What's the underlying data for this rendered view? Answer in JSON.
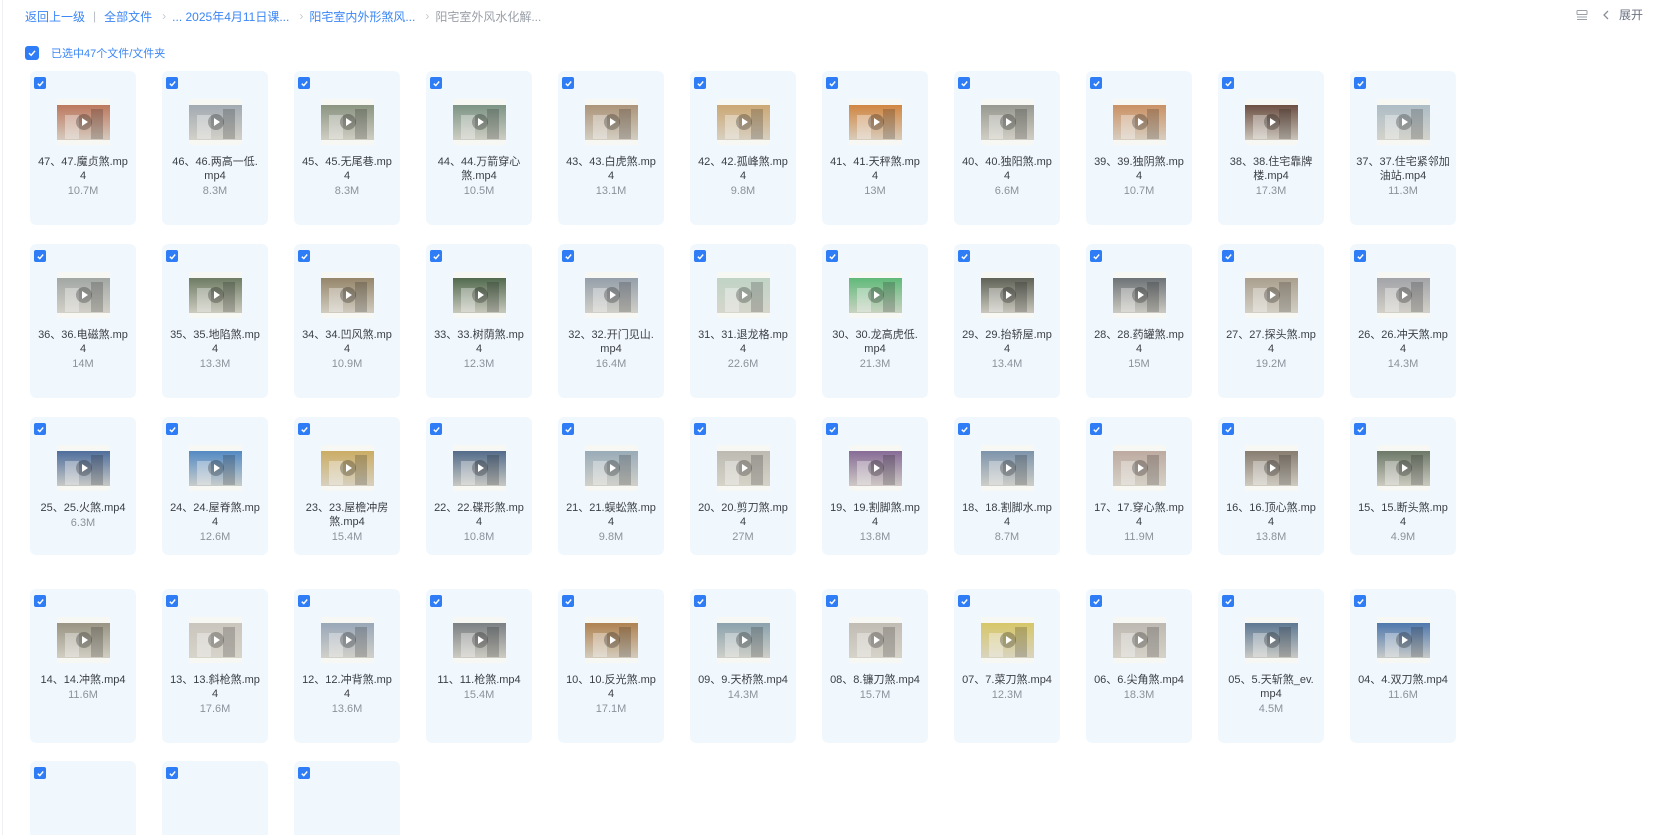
{
  "breadcrumb": {
    "back": "返回上一级",
    "all_files": "全部文件",
    "folder1": "... 2025年4月11日课...",
    "folder2": "阳宅室内外形煞风...",
    "current": "阳宅室外风水化解..."
  },
  "toolbar": {
    "expand_label": "展开"
  },
  "selection": {
    "label": "已选中47个文件/文件夹"
  },
  "colors": {
    "accent": "#2e7cf6",
    "card_bg": "#f1f8fd",
    "link": "#3b86f7"
  },
  "files": [
    {
      "name": "47、47.魔贞煞.mp4",
      "size": "10.7M",
      "tone": "#b86a4e"
    },
    {
      "name": "46、46.两高一低.mp4",
      "size": "8.3M",
      "tone": "#9aa3ad"
    },
    {
      "name": "45、45.无尾巷.mp4",
      "size": "8.3M",
      "tone": "#7f8a76"
    },
    {
      "name": "44、44.万箭穿心煞.mp4",
      "size": "10.5M",
      "tone": "#6f8a7a"
    },
    {
      "name": "43、43.白虎煞.mp4",
      "size": "13.1M",
      "tone": "#a58a6d"
    },
    {
      "name": "42、42.孤峰煞.mp4",
      "size": "9.8M",
      "tone": "#c9a067"
    },
    {
      "name": "41、41.天秤煞.mp4",
      "size": "13M",
      "tone": "#d07a2e"
    },
    {
      "name": "40、40.独阳煞.mp4",
      "size": "6.6M",
      "tone": "#8d8f87"
    },
    {
      "name": "39、39.独阴煞.mp4",
      "size": "10.7M",
      "tone": "#c88755"
    },
    {
      "name": "38、38.住宅靠牌楼.mp4",
      "size": "17.3M",
      "tone": "#5c3b2e"
    },
    {
      "name": "37、37.住宅紧邻加油站.mp4",
      "size": "11.3M",
      "tone": "#a6b8c4"
    },
    {
      "name": "36、36.电磁煞.mp4",
      "size": "14M",
      "tone": "#9aa09f"
    },
    {
      "name": "35、35.地陷煞.mp4",
      "size": "13.3M",
      "tone": "#5f6f55"
    },
    {
      "name": "34、34.凹风煞.mp4",
      "size": "10.9M",
      "tone": "#8b7a5c"
    },
    {
      "name": "33、33.树荫煞.mp4",
      "size": "12.3M",
      "tone": "#3e5a3c"
    },
    {
      "name": "32、32.开门见山.mp4",
      "size": "16.4M",
      "tone": "#8b97a5"
    },
    {
      "name": "31、31.退龙格.mp4",
      "size": "22.6M",
      "tone": "#bcd3c5"
    },
    {
      "name": "30、30.龙高虎低.mp4",
      "size": "21.3M",
      "tone": "#4fb56d"
    },
    {
      "name": "29、29.抬轿屋.mp4",
      "size": "13.4M",
      "tone": "#4d5145"
    },
    {
      "name": "28、28.药罐煞.mp4",
      "size": "15M",
      "tone": "#5d646a"
    },
    {
      "name": "27、27.探头煞.mp4",
      "size": "19.2M",
      "tone": "#a39785"
    },
    {
      "name": "26、26.冲天煞.mp4",
      "size": "14.3M",
      "tone": "#9a9ca3"
    },
    {
      "name": "25、25.火煞.mp4",
      "size": "6.3M",
      "tone": "#3b5f95"
    },
    {
      "name": "24、24.屋脊煞.mp4",
      "size": "12.6M",
      "tone": "#3f7fc2"
    },
    {
      "name": "23、23.屋檐冲房煞.mp4",
      "size": "15.4M",
      "tone": "#c9a655"
    },
    {
      "name": "22、22.碟形煞.mp4",
      "size": "10.8M",
      "tone": "#3f5c80"
    },
    {
      "name": "21、21.蜈蚣煞.mp4",
      "size": "9.8M",
      "tone": "#8fa5b5"
    },
    {
      "name": "20、20.剪刀煞.mp4",
      "size": "27M",
      "tone": "#b9b6ad"
    },
    {
      "name": "19、19.割脚煞.mp4",
      "size": "13.8M",
      "tone": "#7a5c8e"
    },
    {
      "name": "18、18.割脚水.mp4",
      "size": "8.7M",
      "tone": "#6f8aa6"
    },
    {
      "name": "17、17.穿心煞.mp4",
      "size": "11.9M",
      "tone": "#b9a49a"
    },
    {
      "name": "16、16.顶心煞.mp4",
      "size": "13.8M",
      "tone": "#7c6f63"
    },
    {
      "name": "15、15.断头煞.mp4",
      "size": "4.9M",
      "tone": "#5d6b5a"
    },
    {
      "name": "14、14.冲煞.mp4",
      "size": "11.6M",
      "tone": "#8f8a78"
    },
    {
      "name": "13、13.斜枪煞.mp4",
      "size": "17.6M",
      "tone": "#c7c2bb"
    },
    {
      "name": "12、12.冲背煞.mp4",
      "size": "13.6M",
      "tone": "#8fa0b5"
    },
    {
      "name": "11、11.枪煞.mp4",
      "size": "15.4M",
      "tone": "#6d7378"
    },
    {
      "name": "10、10.反光煞.mp4",
      "size": "17.1M",
      "tone": "#a9753e"
    },
    {
      "name": "09、9.天桥煞.mp4",
      "size": "14.3M",
      "tone": "#7f9aa8"
    },
    {
      "name": "08、8.镰刀煞.mp4",
      "size": "15.7M",
      "tone": "#bdb8b0"
    },
    {
      "name": "07、7.菜刀煞.mp4",
      "size": "12.3M",
      "tone": "#d6c45a"
    },
    {
      "name": "06、6.尖角煞.mp4",
      "size": "18.3M",
      "tone": "#b9b4ad"
    },
    {
      "name": "05、5.天斩煞_ev.mp4",
      "size": "4.5M",
      "tone": "#4b6a8a"
    },
    {
      "name": "04、4.双刀煞.mp4",
      "size": "11.6M",
      "tone": "#3a6aa8"
    },
    {
      "name": "",
      "size": "",
      "tone": ""
    },
    {
      "name": "",
      "size": "",
      "tone": ""
    },
    {
      "name": "",
      "size": "",
      "tone": ""
    }
  ]
}
